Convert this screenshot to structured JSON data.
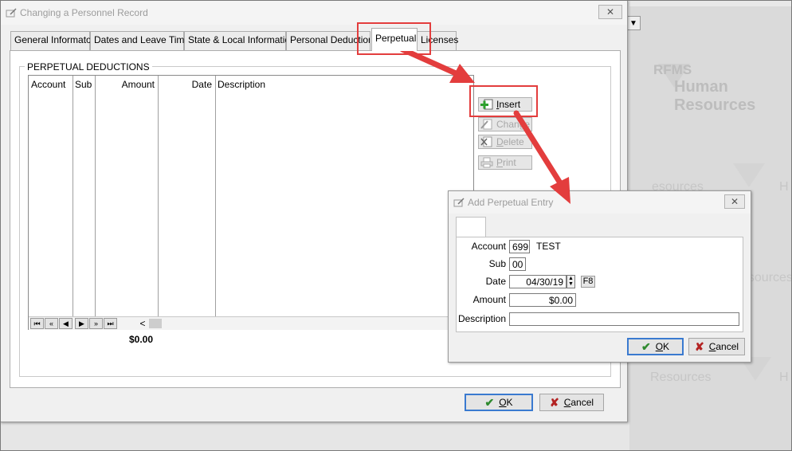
{
  "background": {
    "brand_short": "RFMS",
    "brand_full": "Human Resources",
    "watermark_h": "H",
    "watermark_sources": "esources",
    "watermark_resources": "Resources"
  },
  "main_window": {
    "title": "Changing a Personnel Record",
    "close_glyph": "✕",
    "tabs": [
      {
        "label": "General Informaton"
      },
      {
        "label": "Dates and Leave Time"
      },
      {
        "label": "State & Local Information"
      },
      {
        "label": "Personal Deductions"
      },
      {
        "label": "Perpetual"
      },
      {
        "label": "Licenses"
      }
    ],
    "group_title": "PERPETUAL DEDUCTIONS",
    "grid": {
      "columns": [
        "Account",
        "Sub",
        "Amount",
        "Date",
        "Description"
      ],
      "nav_first": "⏮",
      "nav_prev_page": "«",
      "nav_prev": "◀",
      "nav_next": "▶",
      "nav_next_page": "»",
      "nav_last": "⏭",
      "scroll_left": "<"
    },
    "total": "$0.00",
    "side_buttons": {
      "insert": "Insert",
      "change": "Change",
      "delete": "Delete",
      "print": "Print"
    },
    "ok_label": "OK",
    "cancel_label": "Cancel"
  },
  "dialog": {
    "title": "Add Perpetual Entry",
    "close_glyph": "✕",
    "labels": {
      "account": "Account",
      "sub": "Sub",
      "date": "Date",
      "amount": "Amount",
      "description": "Description"
    },
    "fields": {
      "account": "699",
      "account_name": "TEST",
      "sub": "00",
      "date": "04/30/19",
      "date_key": "F8",
      "amount": "$0.00",
      "description": ""
    },
    "ok_label": "OK",
    "cancel_label": "Cancel"
  },
  "colors": {
    "annotation": "#e33d3d",
    "default_button_border": "#3a7ad0"
  }
}
